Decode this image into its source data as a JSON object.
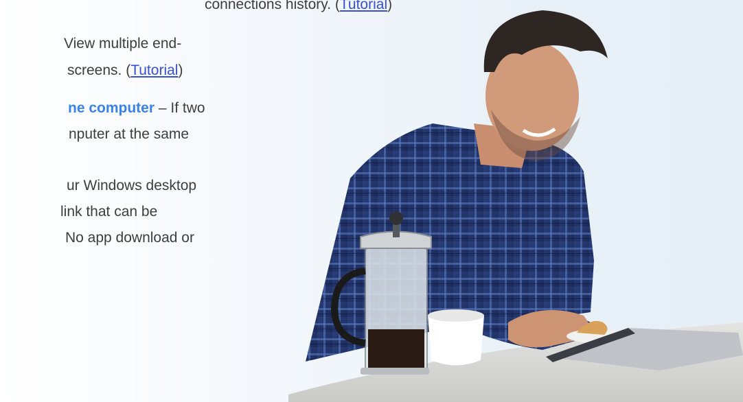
{
  "top_line": {
    "prefix": "connections history. (",
    "link": "Tutorial",
    "suffix": ")"
  },
  "multi_monitor": {
    "line1": "View multiple end-",
    "line2_prefix": "screens. (",
    "link": "Tutorial",
    "line2_suffix": ")"
  },
  "same_computer": {
    "heading": "ne computer",
    "line1_rest": " – If two",
    "line2": "nputer at the same"
  },
  "share_desktop": {
    "line1": "ur Windows desktop",
    "line2": " link that can be",
    "line3": "No app download or"
  },
  "colors": {
    "body_text": "#3d3d3d",
    "link": "#3a4fcf",
    "feature_heading": "#3b82e6",
    "background": "#e9f1f8"
  },
  "image": {
    "icon": "man-with-tablet-photo"
  }
}
